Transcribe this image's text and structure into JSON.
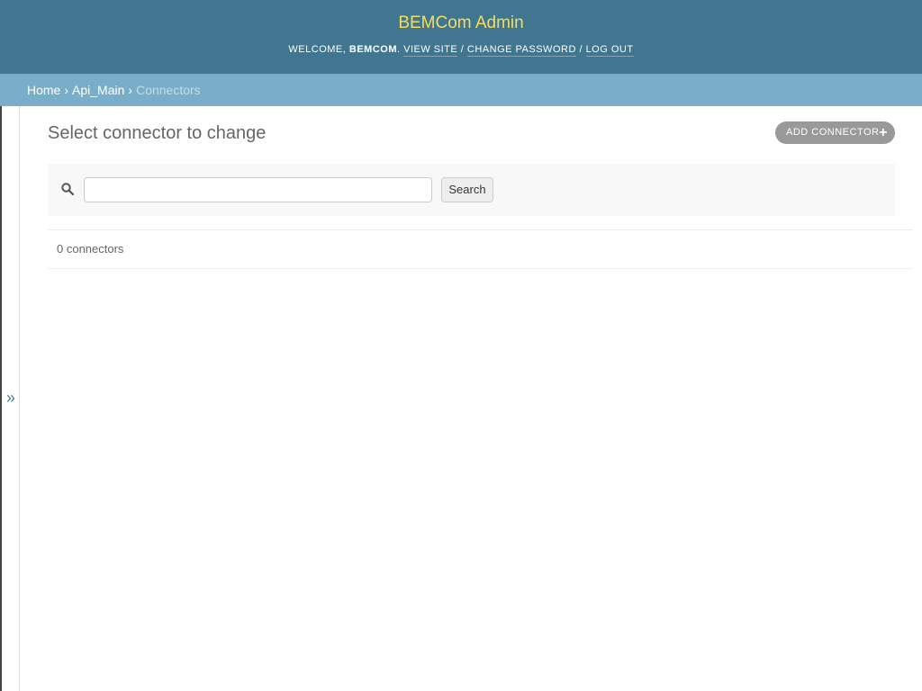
{
  "header": {
    "site_name": "BEMCom Admin",
    "welcome_prefix": "WELCOME, ",
    "username": "BEMCOM",
    "welcome_suffix": ". ",
    "view_site": "VIEW SITE",
    "separator": " / ",
    "change_password": "CHANGE PASSWORD",
    "log_out": "LOG OUT"
  },
  "breadcrumbs": {
    "home": "Home",
    "app": "Api_Main",
    "current": "Connectors",
    "separator": "›"
  },
  "sidebar": {
    "toggle_glyph": "»"
  },
  "content": {
    "title": "Select connector to change",
    "add_button": "ADD CONNECTOR",
    "add_icon_glyph": "+",
    "search": {
      "value": "",
      "placeholder": "",
      "button_label": "Search"
    },
    "result_count": "0 connectors"
  },
  "colors": {
    "header_bg": "#417690",
    "site_name": "#f5dd5d",
    "breadcrumbs_bg": "#79aec8",
    "add_button_bg": "#999999"
  }
}
